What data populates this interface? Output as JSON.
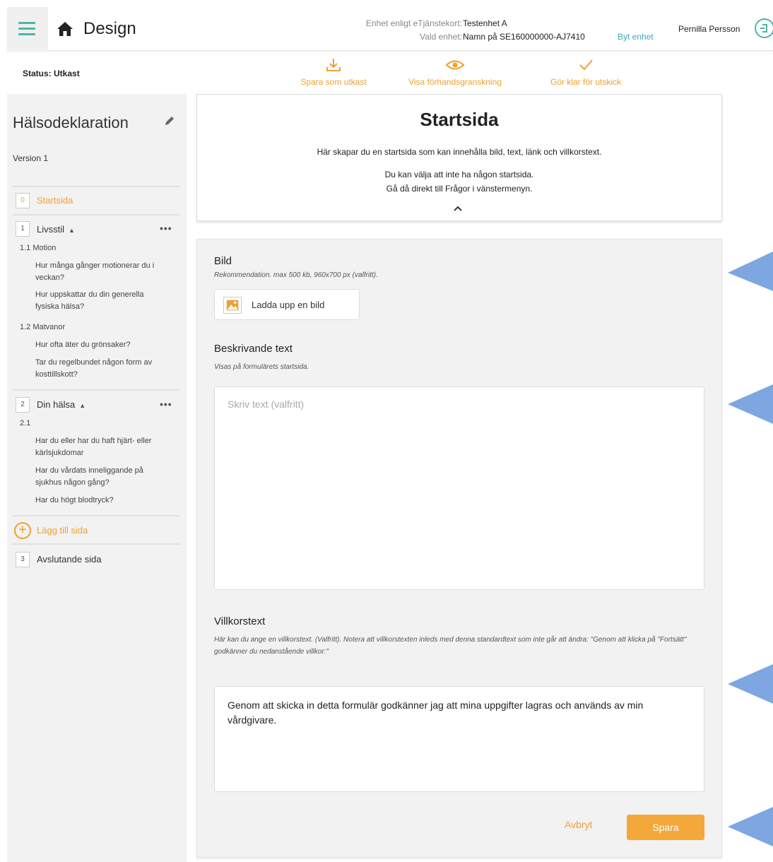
{
  "header": {
    "app_title": "Design",
    "unit_label_1": "Enhet enligt eTjänstekort:",
    "unit_value_1": "Testenhet A",
    "unit_label_2": "Vald enhet:",
    "unit_value_2": "Namn på SE160000000-AJ7410",
    "switch_unit": "Byt enhet",
    "user": "Pernilla Persson"
  },
  "actionbar": {
    "status": "Status: Utkast",
    "save_draft": "Spara som utkast",
    "preview": "Visa förhandsgranskning",
    "publish_ready": "Gör klar för utskick"
  },
  "sidebar": {
    "form_title": "Hälsodeklaration",
    "version": "Version 1",
    "start_badge": "0",
    "start_label": "Startsida",
    "group1_badge": "1",
    "group1_label": "Livsstil",
    "sub1": "1.1 Motion",
    "q1": "Hur många gånger motionerar du i veckan?",
    "q2": "Hur uppskattar du din generella fysiska hälsa?",
    "sub2": "1.2 Matvanor",
    "q3": "Hur ofta äter du grönsaker?",
    "q4": "Tar du regelbundet någon form av kosttillskott?",
    "group2_badge": "2",
    "group2_label": "Din hälsa",
    "sub3": "2.1",
    "q5": "Har du eller har du haft hjärt- eller kärlsjukdomar",
    "q6": "Har du vårdats inneliggande på sjukhus någon gång?",
    "q7": "Har du högt blodtryck?",
    "add_page": "Lägg till sida",
    "end_badge": "3",
    "end_label": "Avslutande sida"
  },
  "start_card": {
    "title": "Startsida",
    "desc": "Här skapar du en startsida som kan innehålla bild, text, länk och villkorstext.",
    "note1": "Du kan välja att inte ha någon startsida.",
    "note2": "Gå då direkt till Frågor i vänstermenyn."
  },
  "editor": {
    "image_title": "Bild",
    "image_hint": "Rekommendation. max 500 kb, 960x700 px (valfritt).",
    "upload_label": "Ladda upp en bild",
    "desc_title": "Beskrivande text",
    "desc_hint": "Visas på formulärets startsida.",
    "desc_placeholder": "Skriv text (valfritt)",
    "terms_title": "Villkorstext",
    "terms_hint": "Här kan du ange en villkorstext. (Valfritt). Notera att villkorstexten inleds med denna standardtext som inte går att ändra: \"Genom att klicka på \"Fortsätt\" godkänner du nedanstående villkor:\"",
    "terms_value": "Genom att skicka in detta formulär godkänner jag att mina uppgifter lagras och används av min vårdgivare.",
    "cancel": "Avbryt",
    "save": "Spara"
  },
  "colors": {
    "accent": "#f0a030",
    "teal": "#4db6a6",
    "pointer": "#7ea6e0"
  }
}
